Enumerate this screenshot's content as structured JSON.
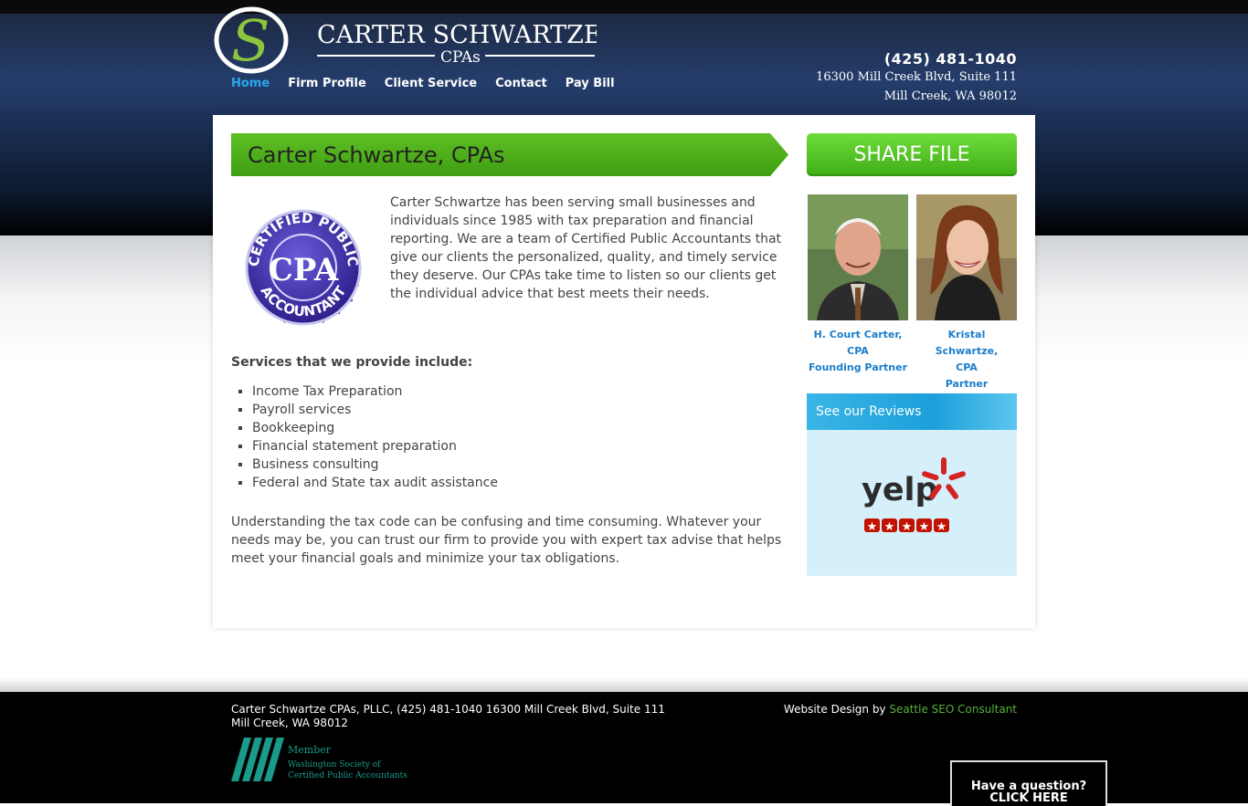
{
  "header": {
    "logo_name": "CARTER SCHWARTZE",
    "logo_sub": "CPAs",
    "phone": "(425) 481-1040",
    "address_line1": "16300 Mill Creek Blvd, Suite 111",
    "address_line2": "Mill Creek, WA 98012"
  },
  "nav": {
    "items": [
      "Home",
      "Firm Profile",
      "Client Service",
      "Contact",
      "Pay Bill"
    ],
    "active": "Home"
  },
  "main": {
    "title": "Carter Schwartze, CPAs",
    "seal_text": [
      "CERTIFIED PUBLIC",
      "CPA",
      "ACCOUNTANT"
    ],
    "intro": "Carter Schwartze has been serving small businesses and individuals since 1985 with tax preparation and financial reporting. We are a team of Certified Public Accountants that give our clients the personalized, quality, and timely service they deserve. Our CPAs take time to listen so our clients get the individual advice that best meets their needs.",
    "services_heading": "Services that we provide include:",
    "services": [
      "Income Tax Preparation",
      "Payroll services",
      "Bookkeeping",
      "Financial statement preparation",
      "Business consulting",
      "Federal and State tax audit assistance"
    ],
    "outro": "Understanding the tax code can be confusing and time consuming. Whatever your needs may be, you can trust our firm to provide you with expert tax advise that helps meet your financial goals and minimize your tax obligations."
  },
  "sidebar": {
    "share_label": "SHARE FILE",
    "people": [
      {
        "name": "H. Court Carter,",
        "cred": "CPA",
        "role": "Founding Partner"
      },
      {
        "name": "Kristal Schwartze,",
        "cred": "CPA",
        "role": "Partner"
      }
    ],
    "reviews_heading": "See our Reviews",
    "yelp_label": "yelp",
    "yelp_stars": 5
  },
  "footer": {
    "line1": "Carter Schwartze CPAs, PLLC, (425) 481-1040 16300 Mill Creek Blvd, Suite 111",
    "line2": "Mill Creek, WA 98012",
    "credit_prefix": "Website Design by ",
    "credit_link": "Seattle SEO Consultant",
    "member_lines": [
      "Member",
      "Washington Society of",
      "Certified Public Accountants"
    ],
    "question_line1": "Have a question?",
    "question_line2": "CLICK HERE"
  },
  "colors": {
    "nav_active": "#2aa8ea",
    "green": "#4caf1f",
    "link_blue": "#1b7ecb",
    "footer_link": "#57b23a"
  }
}
